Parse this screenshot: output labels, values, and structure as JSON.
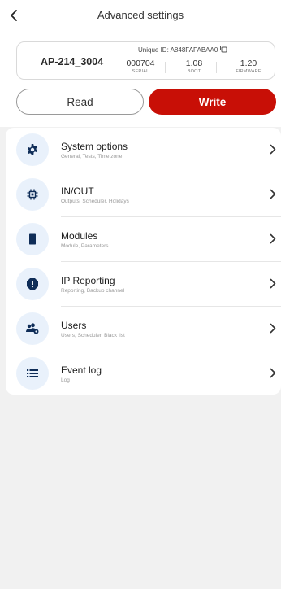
{
  "header": {
    "title": "Advanced settings"
  },
  "device": {
    "name": "AP-214_3004",
    "unique_id": "Unique ID: A848FAFABAA0",
    "stats": [
      {
        "value": "000704",
        "label": "SERIAL"
      },
      {
        "value": "1.08",
        "label": "BOOT"
      },
      {
        "value": "1.20",
        "label": "FIRMWARE"
      }
    ]
  },
  "actions": {
    "read": "Read",
    "write": "Write"
  },
  "menu": [
    {
      "title": "System options",
      "subtitle": "General, Tests, Time zone",
      "icon": "gear-icon"
    },
    {
      "title": "IN/OUT",
      "subtitle": "Outputs, Scheduler, Holidays",
      "icon": "chip-icon"
    },
    {
      "title": "Modules",
      "subtitle": "Module, Parameters",
      "icon": "module-icon"
    },
    {
      "title": "IP Reporting",
      "subtitle": "Reporting, Backup channel",
      "icon": "alert-icon"
    },
    {
      "title": "Users",
      "subtitle": "Users, Scheduler, Black list",
      "icon": "users-icon"
    },
    {
      "title": "Event log",
      "subtitle": "Log",
      "icon": "list-icon"
    }
  ],
  "colors": {
    "accent": "#c80f06",
    "icon_blue": "#0f2d58",
    "icon_bg": "#e9f1fb",
    "background": "#f1f1f1"
  }
}
